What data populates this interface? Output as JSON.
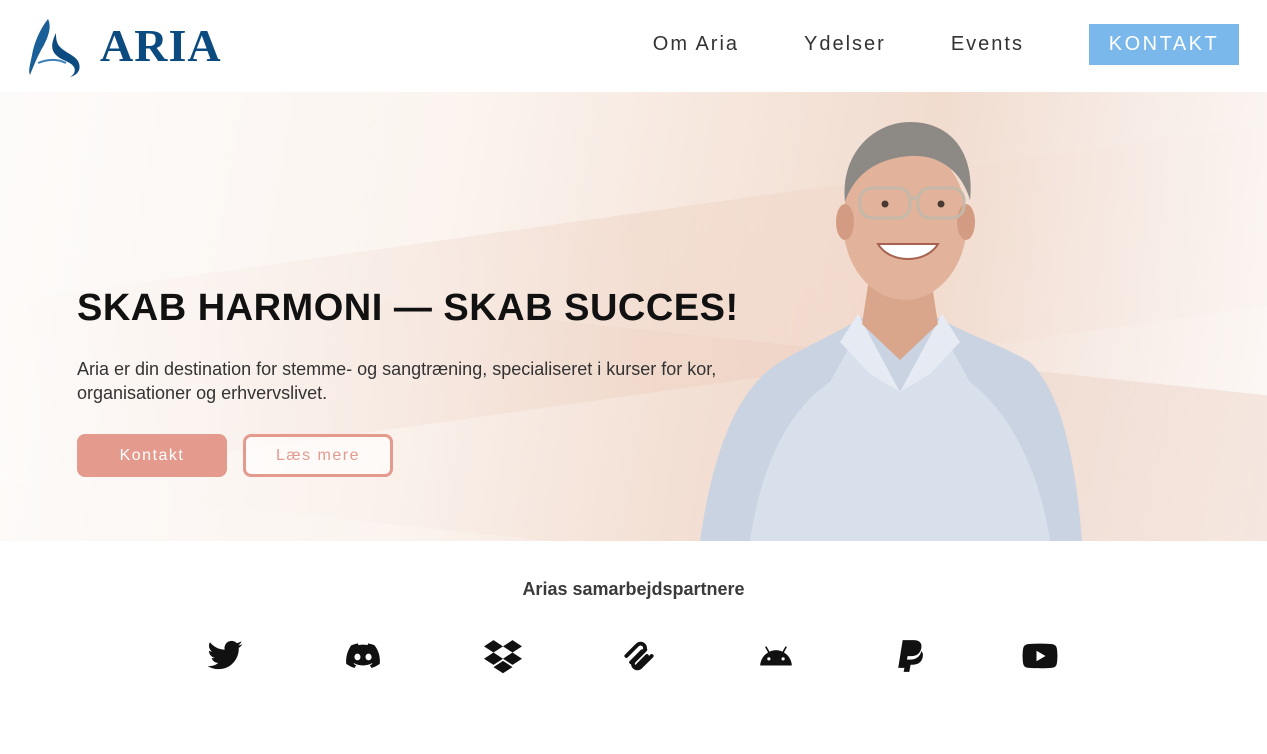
{
  "header": {
    "logo_text": "ARIA",
    "brand_color": "#0c4b80",
    "nav": [
      {
        "label": "Om Aria"
      },
      {
        "label": "Ydelser"
      },
      {
        "label": "Events"
      }
    ],
    "cta_label": "KONTAKT",
    "cta_color": "#7ab8ec"
  },
  "hero": {
    "title": "SKAB HARMONI — SKAB SUCCES!",
    "text": "Aria er din destination for stemme- og sangtræning, specialiseret i kurser for kor, organisationer og erhvervslivet.",
    "primary_button": "Kontakt",
    "secondary_button": "Læs mere",
    "accent_color": "#e49a8d"
  },
  "partners": {
    "title": "Arias samarbejdspartnere",
    "icons": [
      "twitter-icon",
      "discord-icon",
      "dropbox-icon",
      "squarespace-icon",
      "android-icon",
      "paypal-icon",
      "youtube-icon"
    ]
  }
}
